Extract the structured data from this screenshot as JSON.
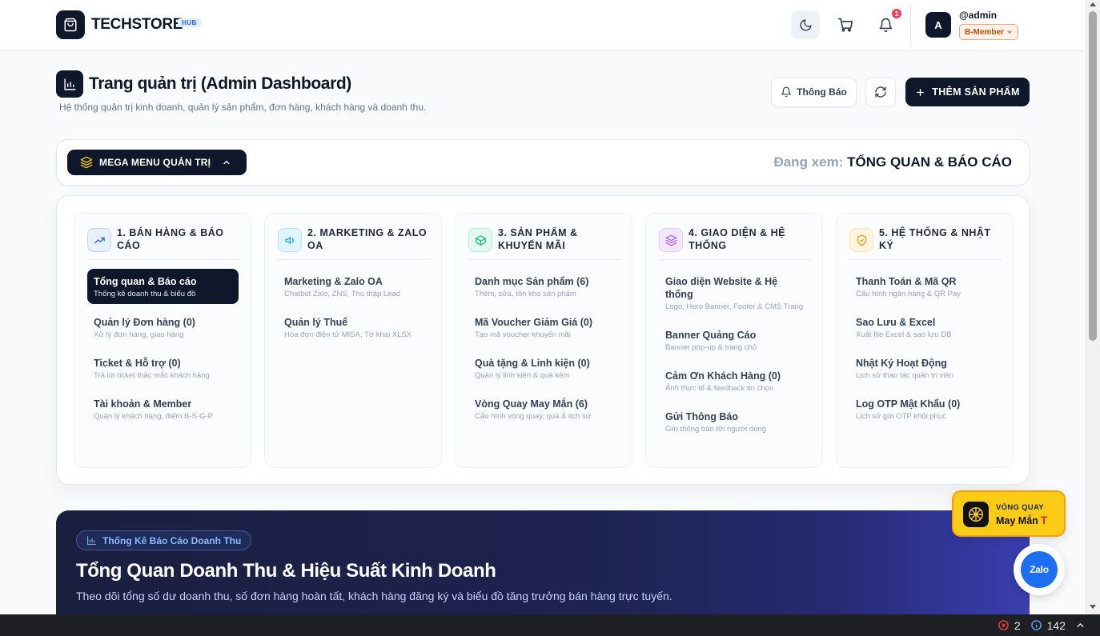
{
  "header": {
    "brand": "TECHSTORE",
    "brand_badge": "HUB",
    "notification_count": "1",
    "avatar_letter": "A",
    "username": "@admin",
    "member_level": "B-Member"
  },
  "page": {
    "title": "Trang quản trị (Admin Dashboard)",
    "subtitle": "Hệ thống quản trị kinh doanh, quản lý sản phẩm, đơn hàng, khách hàng và doanh thu.",
    "btn_notify": "Thông Báo",
    "btn_add": "THÊM SẢN PHẨM"
  },
  "menu_bar": {
    "mega_label": "MEGA MENU QUẢN TRỊ",
    "viewing_label": "Đang xem:",
    "viewing_value": "TỔNG QUAN & BÁO CÁO"
  },
  "mega": {
    "columns": [
      {
        "title": "1. BÁN HÀNG & BÁO CÁO",
        "icon": "trending-up-icon",
        "accent": "#2563eb",
        "items": [
          {
            "name": "Tổng quan & Báo cáo",
            "desc": "Thống kê doanh thu & biểu đồ",
            "active": true
          },
          {
            "name": "Quản lý Đơn hàng (0)",
            "desc": "Xử lý đơn hàng, giao hàng"
          },
          {
            "name": "Ticket & Hỗ trợ (0)",
            "desc": "Trả lời ticket thắc mắc khách hàng"
          },
          {
            "name": "Tài khoản & Member",
            "desc": "Quản lý khách hàng, điểm B-S-G-P"
          }
        ]
      },
      {
        "title": "2. MARKETING & ZALO OA",
        "icon": "megaphone-icon",
        "accent": "#0ea5e9",
        "items": [
          {
            "name": "Marketing & Zalo OA",
            "desc": "Chatbot Zalo, ZNS, Thu thập Lead"
          },
          {
            "name": "Quản lý Thuế",
            "desc": "Hóa đơn điện tử MISA, Tờ khai XLSX"
          }
        ]
      },
      {
        "title": "3. SẢN PHẨM & KHUYẾN MÃI",
        "icon": "box-icon",
        "accent": "#10b981",
        "items": [
          {
            "name": "Danh mục Sản phẩm (6)",
            "desc": "Thêm, sửa, tồn kho sản phẩm"
          },
          {
            "name": "Mã Voucher Giảm Giá (0)",
            "desc": "Tạo mã voucher khuyến mãi"
          },
          {
            "name": "Quà tặng & Linh kiện (0)",
            "desc": "Quản lý linh kiện & quà kèm"
          },
          {
            "name": "Vòng Quay May Mắn (6)",
            "desc": "Cấu hình vòng quay, quà & lịch sử"
          }
        ]
      },
      {
        "title": "4. GIAO DIỆN & HỆ THỐNG",
        "icon": "layers-icon",
        "accent": "#a855f7",
        "items": [
          {
            "name": "Giao diện Website & Hệ thống",
            "desc": "Logo, Hero Banner, Footer & CMS Trang"
          },
          {
            "name": "Banner Quảng Cáo",
            "desc": "Banner pop-up & trang chủ"
          },
          {
            "name": "Cảm Ơn Khách Hàng (0)",
            "desc": "Ảnh thực tế & feedback tin chọn"
          },
          {
            "name": "Gửi Thông Báo",
            "desc": "Gửi thông báo tới người dùng"
          }
        ]
      },
      {
        "title": "5. HỆ THỐNG & NHẬT KÝ",
        "icon": "shield-icon",
        "accent": "#f59e0b",
        "items": [
          {
            "name": "Thanh Toán & Mã QR",
            "desc": "Cấu hình ngân hàng & QR Pay"
          },
          {
            "name": "Sao Lưu & Excel",
            "desc": "Xuất file Excel & sao lưu DB"
          },
          {
            "name": "Nhật Ký Hoạt Động",
            "desc": "Lịch sử thao tác quản trị viên"
          },
          {
            "name": "Log OTP Mật Khẩu (0)",
            "desc": "Lịch sử gửi OTP khôi phục"
          }
        ]
      }
    ]
  },
  "hero": {
    "tag": "Thống Kê Báo Cáo Doanh Thu",
    "title": "Tổng Quan Doanh Thu & Hiệu Suất Kinh Doanh",
    "subtitle": "Theo dõi tổng số dư doanh thu, số đơn hàng hoàn tất, khách hàng đăng ký và biểu đồ tăng trưởng bán hàng trực tuyến."
  },
  "widgets": {
    "lucky_line1": "VÒNG QUAY",
    "lucky_line2": "May Mắn",
    "lucky_mark": "T",
    "zalo_label": "Zalo"
  },
  "devbar": {
    "errors": "2",
    "infos": "142"
  }
}
